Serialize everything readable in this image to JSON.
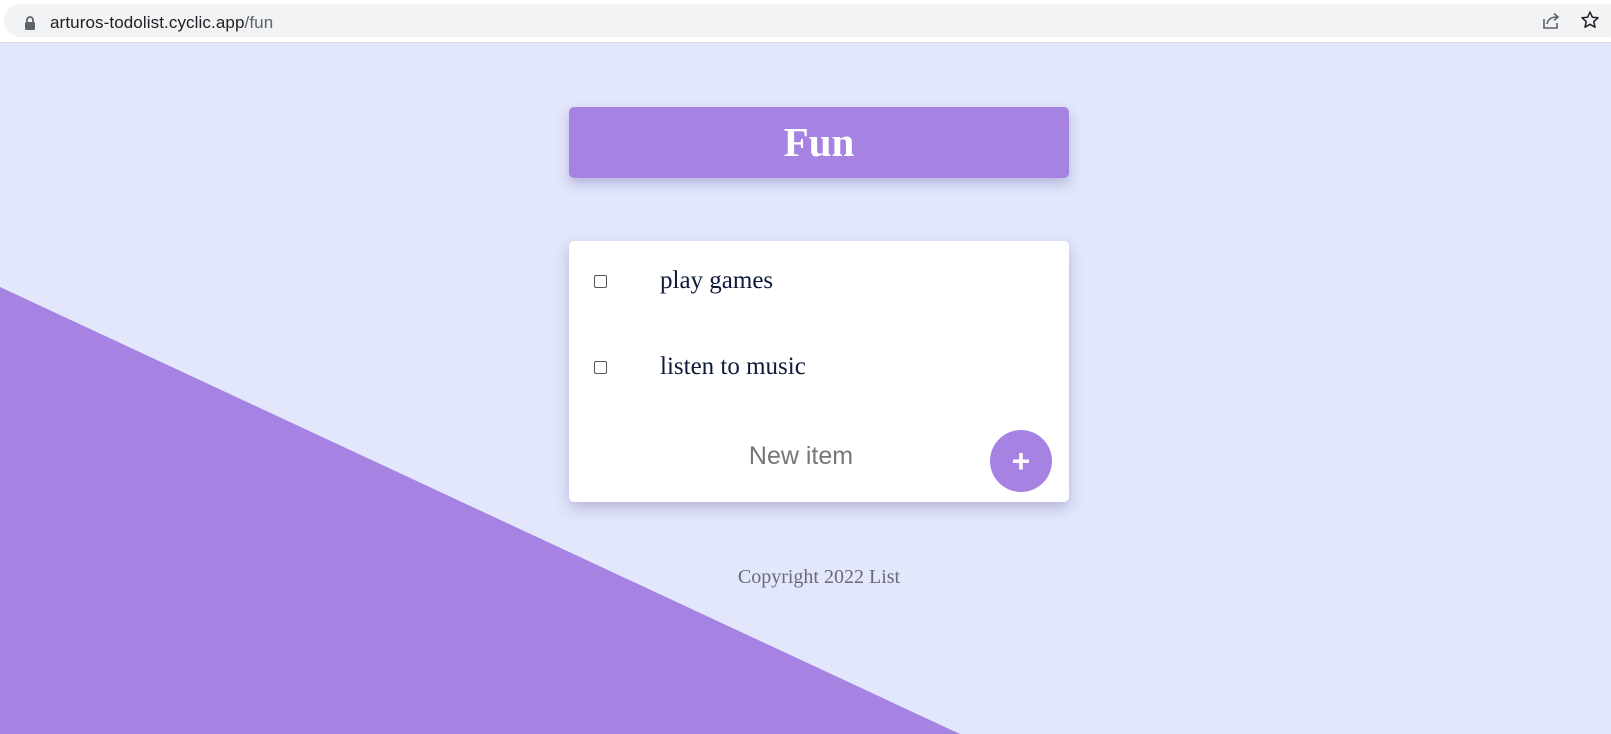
{
  "browser": {
    "url_host": "arturos-todolist.cyclic.app",
    "url_path": "/fun"
  },
  "list": {
    "title": "Fun",
    "items": [
      {
        "label": "play games",
        "checked": false
      },
      {
        "label": "listen to music",
        "checked": false
      }
    ],
    "new_item_placeholder": "New item",
    "add_button_label": "+"
  },
  "footer": {
    "text": "Copyright 2022 List"
  },
  "colors": {
    "accent": "#a683e3",
    "background": "#e2e7fb",
    "card": "#ffffff",
    "item_text": "#0f1a3a",
    "footer_text": "#6b6b78"
  },
  "icons": [
    "lock-icon",
    "share-icon",
    "star-icon"
  ]
}
